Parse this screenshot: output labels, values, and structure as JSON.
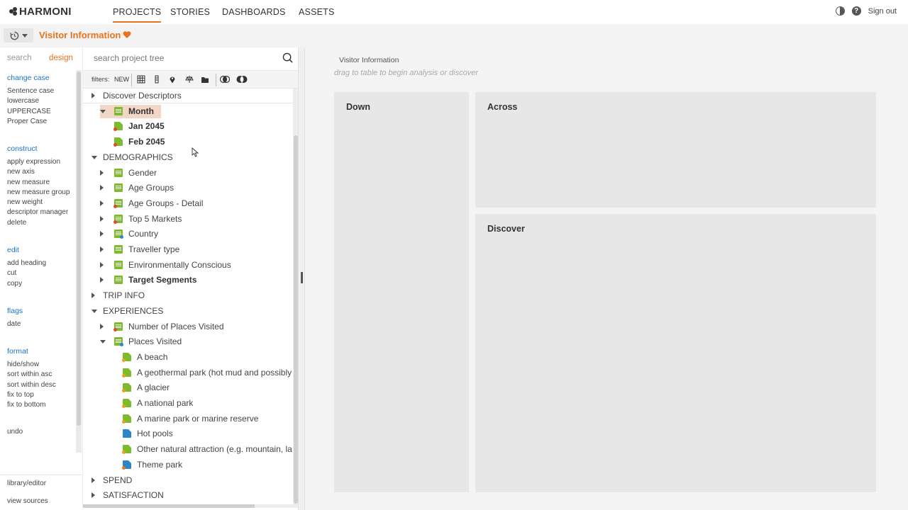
{
  "brand": {
    "name": "HARMONI"
  },
  "nav": {
    "tabs": [
      {
        "label": "PROJECTS",
        "active": true
      },
      {
        "label": "STORIES"
      },
      {
        "label": "DASHBOARDS"
      },
      {
        "label": "ASSETS"
      }
    ],
    "sign_out": "Sign out"
  },
  "breadcrumb": {
    "title": "Visitor Information"
  },
  "sidebar": {
    "tabs": [
      {
        "label": "search"
      },
      {
        "label": "design",
        "active": true
      }
    ],
    "groups": [
      {
        "heading": "change case",
        "items": [
          "Sentence case",
          "lowercase",
          "UPPERCASE",
          "Proper Case"
        ]
      },
      {
        "heading": "construct",
        "items": [
          "apply expression",
          "new axis",
          "new measure",
          "new measure group",
          "new weight",
          "descriptor manager",
          "delete"
        ]
      },
      {
        "heading": "edit",
        "items": [
          "add heading",
          "cut",
          "copy"
        ]
      },
      {
        "heading": "flags",
        "items": [
          "date"
        ]
      },
      {
        "heading": "format",
        "items": [
          "hide/show",
          "sort within asc",
          "sort within desc",
          "fix to top",
          "fix to bottom"
        ]
      }
    ],
    "undo": "undo",
    "footer": {
      "library_editor": "library/editor",
      "view_sources": "view sources"
    }
  },
  "tree_panel": {
    "search_placeholder": "search project tree",
    "filters_label": "filters:",
    "filters_new": "NEW",
    "rows": [
      {
        "label": "Discover Descriptors",
        "level": 0,
        "caret": "right"
      },
      {
        "label": "Month",
        "level": 1,
        "caret": "down",
        "icon": "list",
        "bold": true,
        "highlight": true
      },
      {
        "label": "Jan 2045",
        "level": 2,
        "icon": "leaf",
        "bold": true,
        "dot": "red"
      },
      {
        "label": "Feb 2045",
        "level": 2,
        "icon": "leaf",
        "bold": true,
        "dot": "red"
      },
      {
        "label": "DEMOGRAPHICS",
        "level": 0,
        "caret": "down"
      },
      {
        "label": "Gender",
        "level": 1,
        "caret": "right",
        "icon": "list"
      },
      {
        "label": "Age Groups",
        "level": 1,
        "caret": "right",
        "icon": "list"
      },
      {
        "label": "Age Groups - Detail",
        "level": 1,
        "caret": "right",
        "icon": "list",
        "dot": "red"
      },
      {
        "label": "Top 5 Markets",
        "level": 1,
        "caret": "right",
        "icon": "list",
        "dot": "red"
      },
      {
        "label": "Country",
        "level": 1,
        "caret": "right",
        "icon": "list",
        "dot": "blue"
      },
      {
        "label": "Traveller type",
        "level": 1,
        "caret": "right",
        "icon": "list"
      },
      {
        "label": "Environmentally Conscious",
        "level": 1,
        "caret": "right",
        "icon": "list"
      },
      {
        "label": "Target Segments",
        "level": 1,
        "caret": "right",
        "icon": "list",
        "bold": true
      },
      {
        "label": "TRIP INFO",
        "level": 0,
        "caret": "right"
      },
      {
        "label": "EXPERIENCES",
        "level": 0,
        "caret": "down"
      },
      {
        "label": "Number of Places Visited",
        "level": 1,
        "caret": "right",
        "icon": "list",
        "dot": "red"
      },
      {
        "label": "Places Visited",
        "level": 1,
        "caret": "down",
        "icon": "list",
        "dot": "blue"
      },
      {
        "label": "A beach",
        "level": 3,
        "icon": "leaf",
        "dot": "gold"
      },
      {
        "label": "A geothermal park (hot mud and possibly",
        "level": 3,
        "icon": "leaf",
        "dot": "gold"
      },
      {
        "label": "A glacier",
        "level": 3,
        "icon": "leaf",
        "dot": "gold"
      },
      {
        "label": "A national park",
        "level": 3,
        "icon": "leaf",
        "dot": "gold"
      },
      {
        "label": "A marine park or marine reserve",
        "level": 3,
        "icon": "leaf",
        "dot": "gold"
      },
      {
        "label": "Hot pools",
        "level": 3,
        "icon": "leaf",
        "color": "blue"
      },
      {
        "label": "Other natural attraction (e.g. mountain, la",
        "level": 3,
        "icon": "leaf",
        "dot": "gold"
      },
      {
        "label": "Theme park",
        "level": 3,
        "icon": "leaf",
        "color": "blue",
        "dot": "orange"
      },
      {
        "label": "SPEND",
        "level": 0,
        "caret": "right"
      },
      {
        "label": "SATISFACTION",
        "level": 0,
        "caret": "right"
      }
    ]
  },
  "main": {
    "title": "Visitor Information",
    "hint": "drag to table to begin analysis or discover",
    "zones": {
      "down": "Down",
      "across": "Across",
      "discover": "Discover"
    }
  },
  "colors": {
    "accent": "#e8731e",
    "link": "#1a73c8",
    "icon_green": "#7dbb2c",
    "icon_blue": "#2a86c9"
  }
}
